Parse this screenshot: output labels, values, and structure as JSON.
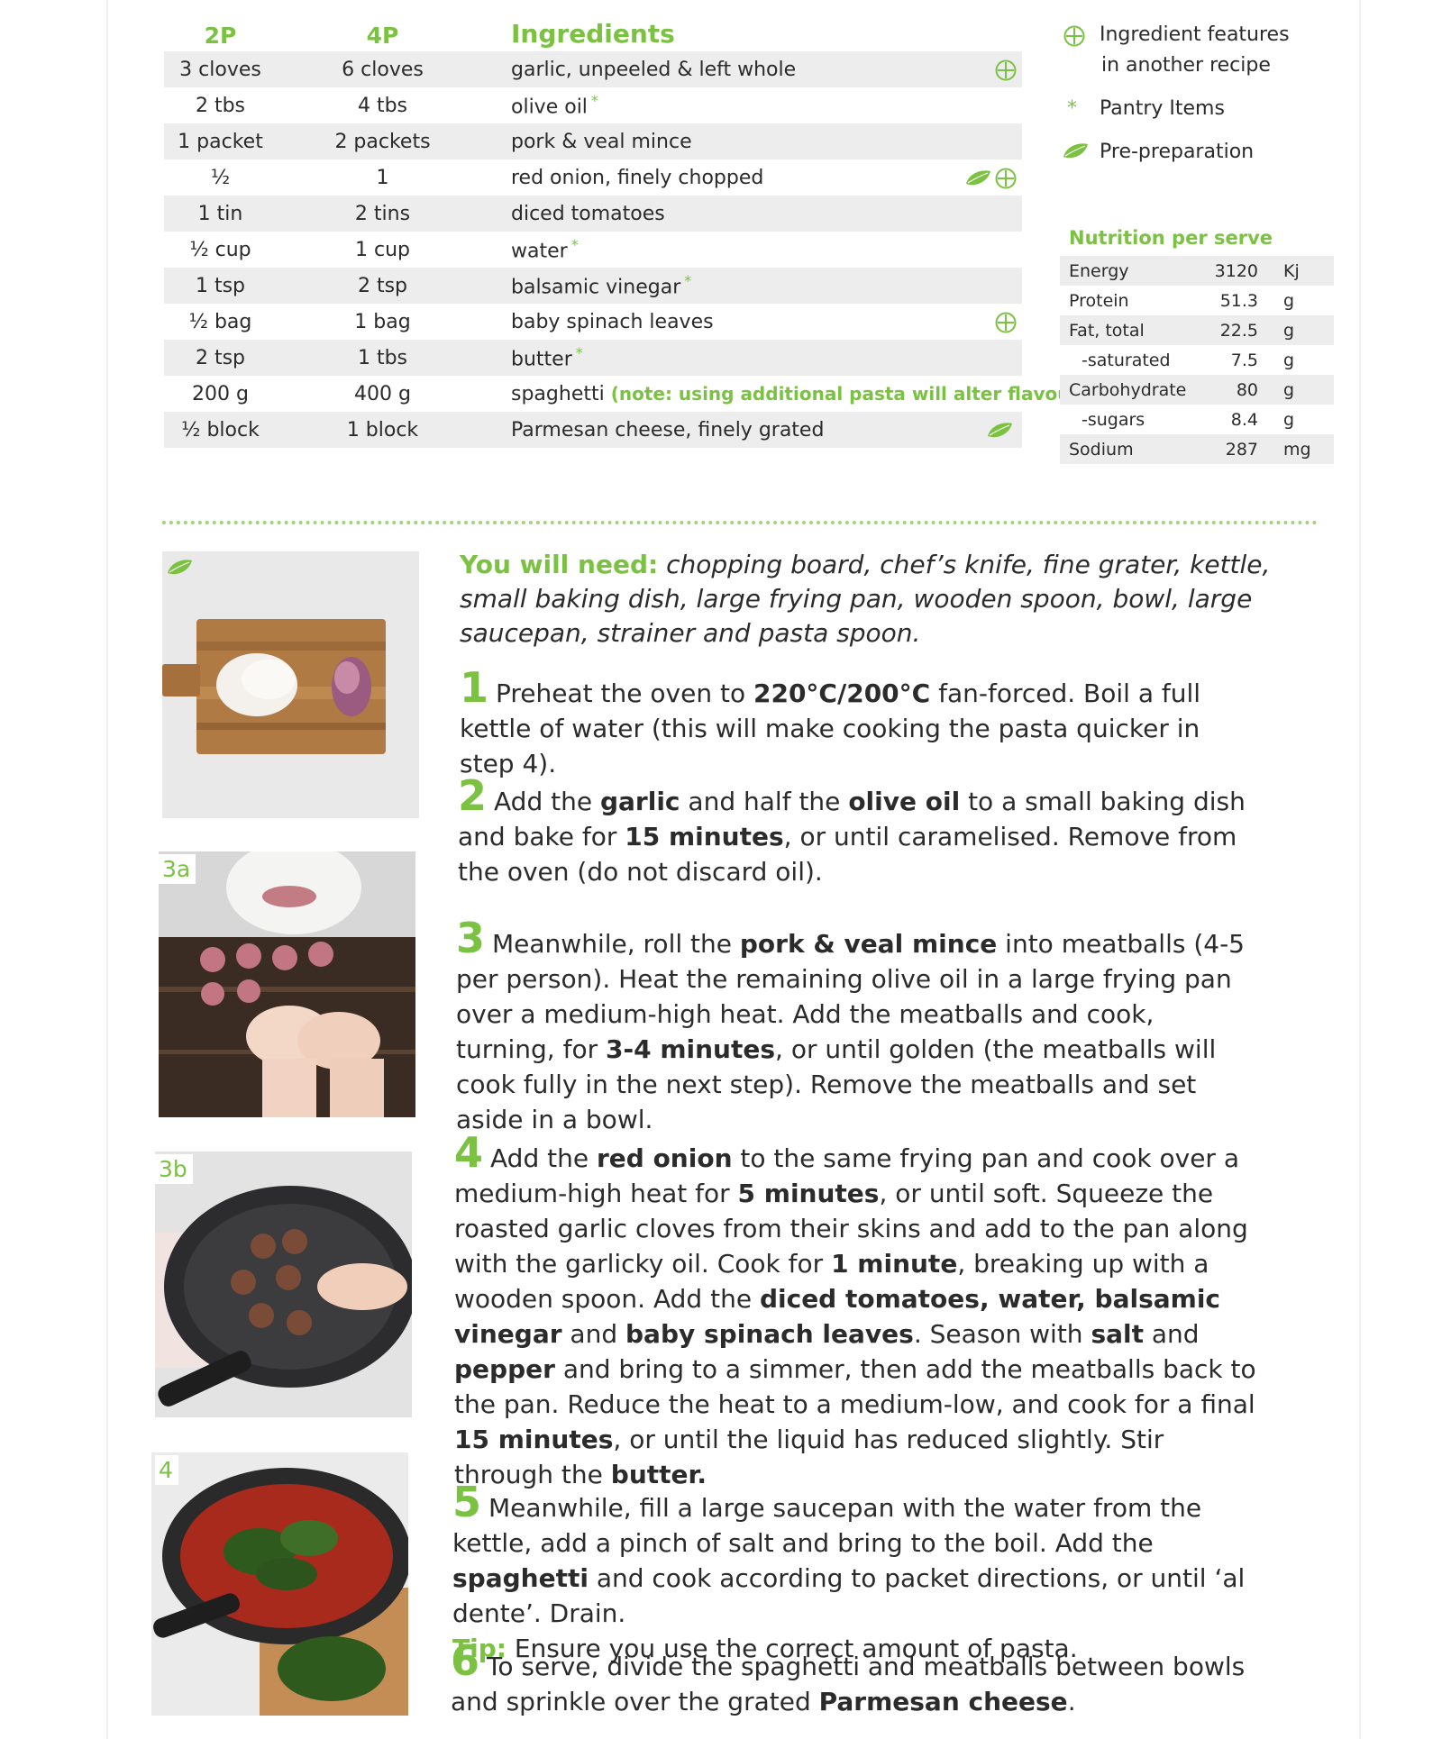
{
  "ingredients": {
    "headers": {
      "two_p": "2P",
      "four_p": "4P",
      "name": "Ingredients"
    },
    "rows": [
      {
        "two_p": "3 cloves",
        "four_p": "6 cloves",
        "name": "garlic, unpeeled & left whole",
        "star": false,
        "note": "",
        "icons": [
          "plus"
        ]
      },
      {
        "two_p": "2 tbs",
        "four_p": "4 tbs",
        "name": "olive oil",
        "star": true,
        "note": "",
        "icons": []
      },
      {
        "two_p": "1 packet",
        "four_p": "2 packets",
        "name": "pork & veal mince",
        "star": false,
        "note": "",
        "icons": []
      },
      {
        "two_p": "½",
        "four_p": "1",
        "name": "red onion, finely chopped",
        "star": false,
        "note": "",
        "icons": [
          "leaf",
          "plus"
        ]
      },
      {
        "two_p": "1 tin",
        "four_p": "2 tins",
        "name": "diced tomatoes",
        "star": false,
        "note": "",
        "icons": []
      },
      {
        "two_p": "½ cup",
        "four_p": "1 cup",
        "name": "water",
        "star": true,
        "note": "",
        "icons": []
      },
      {
        "two_p": "1 tsp",
        "four_p": "2 tsp",
        "name": "balsamic vinegar",
        "star": true,
        "note": "",
        "icons": []
      },
      {
        "two_p": "½ bag",
        "four_p": "1 bag",
        "name": "baby spinach leaves",
        "star": false,
        "note": "",
        "icons": [
          "plus"
        ]
      },
      {
        "two_p": "2 tsp",
        "four_p": "1 tbs",
        "name": "butter",
        "star": true,
        "note": "",
        "icons": []
      },
      {
        "two_p": "200 g",
        "four_p": "400 g",
        "name": "spaghetti",
        "star": false,
        "note": "(note: using additional pasta will alter flavour)",
        "icons": []
      },
      {
        "two_p": "½ block",
        "four_p": "1 block",
        "name": "Parmesan cheese, finely grated",
        "star": false,
        "note": "",
        "icons": [
          "leaf"
        ]
      }
    ]
  },
  "legend": {
    "feature_line1": "Ingredient features",
    "feature_line2": "in another recipe",
    "pantry": "Pantry Items",
    "prep": "Pre-preparation",
    "star_symbol": "*"
  },
  "nutrition": {
    "title": "Nutrition per serve",
    "rows": [
      {
        "label": "Energy",
        "value": "3120",
        "unit": "Kj",
        "sub": false
      },
      {
        "label": "Protein",
        "value": "51.3",
        "unit": "g",
        "sub": false
      },
      {
        "label": "Fat, total",
        "value": "22.5",
        "unit": "g",
        "sub": false
      },
      {
        "label": "-saturated",
        "value": "7.5",
        "unit": "g",
        "sub": true
      },
      {
        "label": "Carbohydrate",
        "value": "80",
        "unit": "g",
        "sub": false
      },
      {
        "label": "-sugars",
        "value": "8.4",
        "unit": "g",
        "sub": true
      },
      {
        "label": "Sodium",
        "value": "287",
        "unit": "mg",
        "sub": false
      }
    ]
  },
  "photos": {
    "label_3a": "3a",
    "label_3b": "3b",
    "label_4": "4"
  },
  "you_will_need": {
    "label": "You will need:",
    "text": " chopping board, chef’s knife, fine grater, kettle, small baking dish, large frying pan, wooden spoon, bowl, large saucepan, strainer and pasta spoon."
  },
  "steps": {
    "s1": {
      "num": "1",
      "t1": "Preheat the oven to ",
      "b1": "220°C/200°C",
      "t2": " fan-forced. Boil a full kettle of water (this will make cooking the pasta quicker in step 4)."
    },
    "s2": {
      "num": "2",
      "t1": "Add the ",
      "b1": "garlic",
      "t2": " and half the ",
      "b2": "olive oil",
      "t3": " to a small baking dish and bake for ",
      "b3": "15 minutes",
      "t4": ", or until caramelised. Remove from the oven (do not discard oil)."
    },
    "s3": {
      "num": "3",
      "t1": "Meanwhile, roll the ",
      "b1": "pork & veal mince",
      "t2": " into meatballs (4-5 per person). Heat the remaining olive oil in a large frying pan over a medium-high heat. Add the meatballs and cook, turning, for ",
      "b2": "3-4 minutes",
      "t3": ", or until golden (the meatballs will cook fully in the next step). Remove the meatballs and set aside in a bowl."
    },
    "s4": {
      "num": "4",
      "t1": "Add the ",
      "b1": "red onion",
      "t2": " to the same frying pan and cook over a medium-high heat for ",
      "b2": "5 minutes",
      "t3": ", or until soft. Squeeze the roasted garlic cloves from their skins and add to the pan along with the garlicky oil. Cook for ",
      "b3": "1 minute",
      "t4": ", breaking up with a wooden spoon. Add the ",
      "b4": "diced tomatoes, water, balsamic vinegar",
      "t5": " and ",
      "b5": "baby spinach leaves",
      "t6": ". Season with ",
      "b6": "salt",
      "t7": " and ",
      "b7": "pepper",
      "t8": " and bring to a simmer, then add the meatballs back to the pan. Reduce the heat to a medium-low, and cook for a final ",
      "b8": "15 minutes",
      "t9": ", or until the liquid has reduced slightly. Stir through the ",
      "b9": "butter."
    },
    "s5": {
      "num": "5",
      "t1": "Meanwhile, fill a large saucepan with the water from the kettle, add a pinch of salt and bring to the boil. Add the ",
      "b1": "spaghetti",
      "t2": " and cook according to packet directions, or until ‘al dente’. Drain.",
      "tip_label": "Tip:",
      "tip_text": " Ensure you use the correct amount of pasta."
    },
    "s6": {
      "num": "6",
      "t1": "To serve, divide the spaghetti and meatballs between bowls and sprinkle over the grated ",
      "b1": "Parmesan cheese",
      "t2": "."
    }
  },
  "colors": {
    "accent": "#7bc142",
    "row_shade": "#ededed",
    "text": "#2b2b2b"
  }
}
